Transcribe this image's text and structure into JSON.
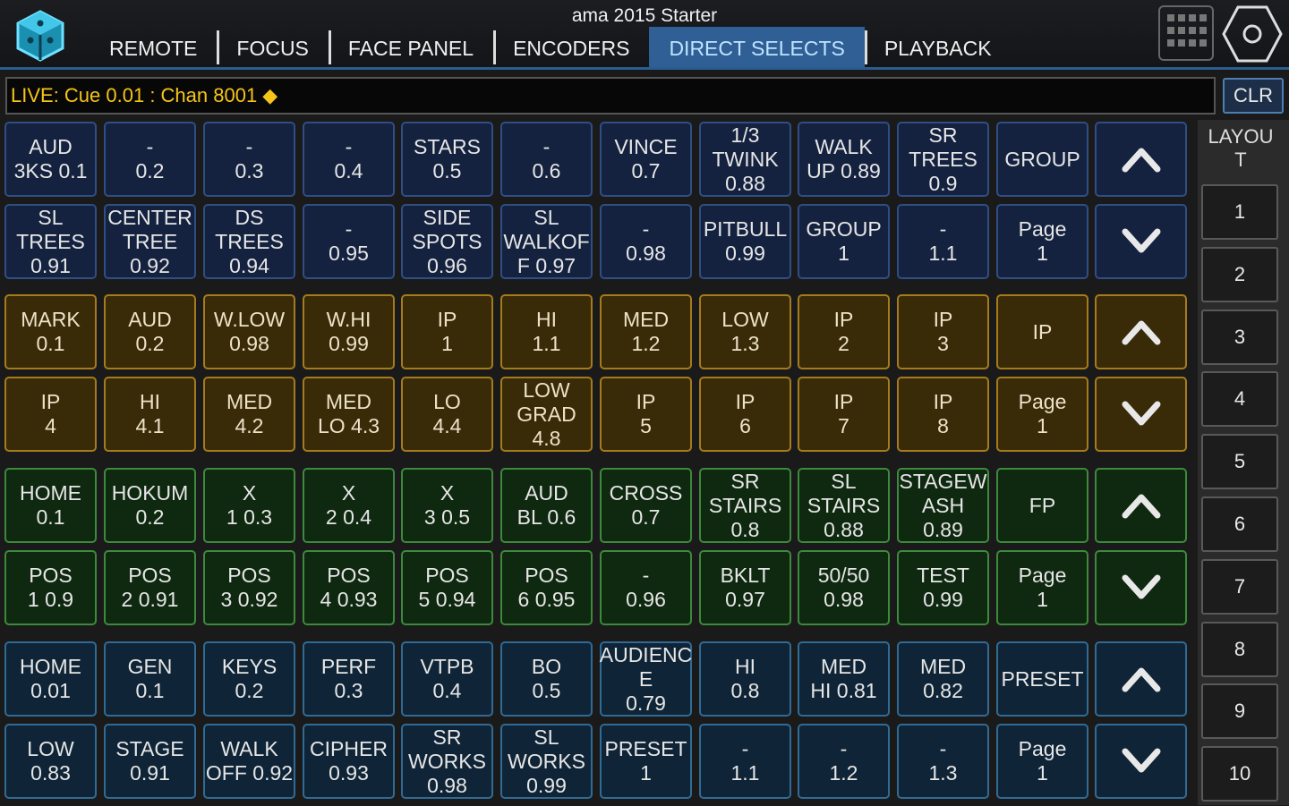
{
  "header": {
    "title": "ama 2015 Starter",
    "tabs": [
      {
        "label": "REMOTE",
        "active": false
      },
      {
        "label": "FOCUS",
        "active": false
      },
      {
        "label": "FACE PANEL",
        "active": false
      },
      {
        "label": "ENCODERS",
        "active": false
      },
      {
        "label": "DIRECT SELECTS",
        "active": true
      },
      {
        "label": "PLAYBACK",
        "active": false
      }
    ]
  },
  "command_line": {
    "text": "LIVE: Cue  0.01 : Chan 8001 ◆",
    "clear_label": "CLR"
  },
  "banks": [
    {
      "theme": "blue",
      "row1": [
        "AUD\n3KS 0.1",
        "-\n0.2",
        "-\n0.3",
        "-\n0.4",
        "STARS\n0.5",
        "-\n0.6",
        "VINCE\n0.7",
        "1/3\nTWINK\n0.88",
        "WALK\nUP 0.89",
        "SR\nTREES\n0.9",
        "GROUP"
      ],
      "row2": [
        "SL\nTREES\n0.91",
        "CENTER\nTREE\n0.92",
        "DS\nTREES\n0.94",
        "-\n0.95",
        "SIDE\nSPOTS\n0.96",
        "SL\nWALKOF\nF 0.97",
        "-\n0.98",
        "PITBULL\n0.99",
        "GROUP\n1",
        "-\n1.1",
        "Page\n1"
      ]
    },
    {
      "theme": "gold",
      "row1": [
        "MARK\n0.1",
        "AUD\n0.2",
        "W.LOW\n0.98",
        "W.HI\n0.99",
        "IP\n1",
        "HI\n1.1",
        "MED\n1.2",
        "LOW\n1.3",
        "IP\n2",
        "IP\n3",
        "IP"
      ],
      "row2": [
        "IP\n4",
        "HI\n4.1",
        "MED\n4.2",
        "MED\nLO 4.3",
        "LO\n4.4",
        "LOW\nGRAD 4.8",
        "IP\n5",
        "IP\n6",
        "IP\n7",
        "IP\n8",
        "Page\n1"
      ]
    },
    {
      "theme": "green",
      "row1": [
        "HOME\n0.1",
        "HOKUM\n0.2",
        "X\n1 0.3",
        "X\n2 0.4",
        "X\n3 0.5",
        "AUD\nBL 0.6",
        "CROSS\n0.7",
        "SR\nSTAIRS\n0.8",
        "SL\nSTAIRS\n0.88",
        "STAGEW\nASH\n0.89",
        "FP"
      ],
      "row2": [
        "POS\n1 0.9",
        "POS\n2 0.91",
        "POS\n3 0.92",
        "POS\n4 0.93",
        "POS\n5 0.94",
        "POS\n6 0.95",
        "-\n0.96",
        "BKLT\n0.97",
        "50/50\n0.98",
        "TEST\n0.99",
        "Page\n1"
      ]
    },
    {
      "theme": "teal",
      "row1": [
        "HOME\n0.01",
        "GEN\n0.1",
        "KEYS\n0.2",
        "PERF\n0.3",
        "VTPB\n0.4",
        "BO\n0.5",
        "AUDIENC\nE\n0.79",
        "HI\n0.8",
        "MED\nHI 0.81",
        "MED\n0.82",
        "PRESET"
      ],
      "row2": [
        "LOW\n0.83",
        "STAGE\n0.91",
        "WALK\nOFF 0.92",
        "CIPHER\n0.93",
        "SR\nWORKS\n0.98",
        "SL\nWORKS\n0.99",
        "PRESET\n1",
        "-\n1.1",
        "-\n1.2",
        "-\n1.3",
        "Page\n1"
      ]
    }
  ],
  "layout": {
    "title": "LAYOU\nT",
    "buttons": [
      "1",
      "2",
      "3",
      "4",
      "5",
      "6",
      "7",
      "8",
      "9",
      "10"
    ]
  },
  "icons": {
    "logo": "cube-logo-icon",
    "grid": "grid-icon",
    "settings": "hexagon-settings-icon",
    "up": "chevron-up-icon",
    "down": "chevron-down-icon"
  },
  "colors": {
    "accent": "#2f5f95",
    "command_text": "#f5c518",
    "blue_border": "#2f4e84",
    "gold_border": "#a57b1c",
    "green_border": "#3c8a3c",
    "teal_border": "#2f6b96"
  }
}
